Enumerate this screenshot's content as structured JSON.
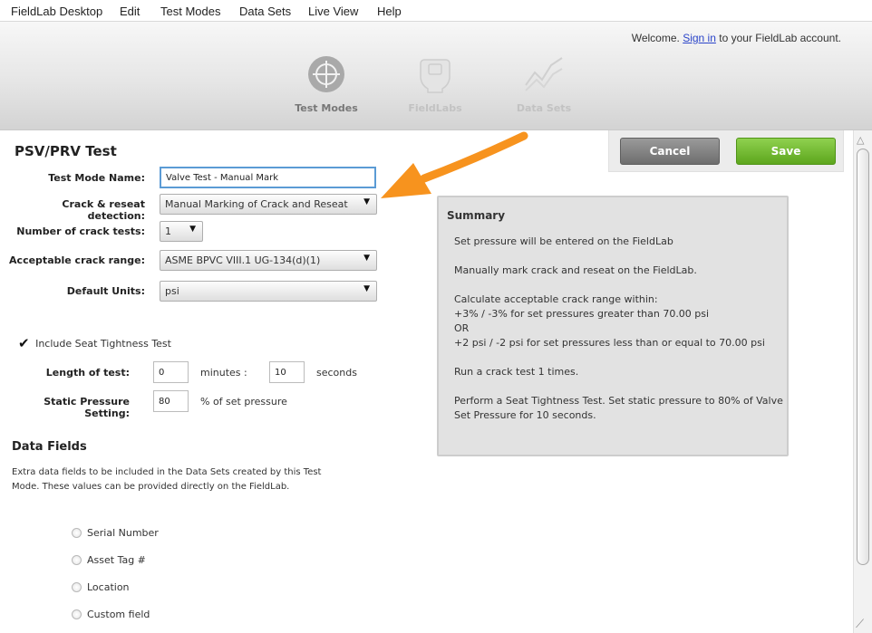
{
  "menu": [
    "FieldLab Desktop",
    "Edit",
    "Test Modes",
    "Data Sets",
    "Live View",
    "Help"
  ],
  "header": {
    "welcome_prefix": "Welcome.",
    "sign_in": "Sign in",
    "welcome_suffix": "to your FieldLab account.",
    "nav": [
      {
        "label": "Test Modes",
        "icon": "crosshair-icon"
      },
      {
        "label": "FieldLabs",
        "icon": "fieldlab-device-icon"
      },
      {
        "label": "Data Sets",
        "icon": "chart-line-icon"
      }
    ]
  },
  "form": {
    "title": "PSV/PRV Test",
    "test_mode_name": {
      "label": "Test Mode Name:",
      "value": "Valve Test - Manual Mark"
    },
    "crack_detection": {
      "label": "Crack & reseat detection:",
      "value": "Manual Marking of Crack and Reseat"
    },
    "num_crack_tests": {
      "label": "Number of crack tests:",
      "value": "1"
    },
    "crack_range": {
      "label": "Acceptable crack range:",
      "value": "ASME BPVC VIII.1 UG-134(d)(1)"
    },
    "default_units": {
      "label": "Default Units:",
      "value": "psi"
    },
    "include_seat": {
      "label": "Include Seat Tightness Test",
      "checked": true
    },
    "length_of_test": {
      "label": "Length of test:",
      "minutes_value": "0",
      "minutes_label": "minutes :",
      "seconds_value": "10",
      "seconds_label": "seconds"
    },
    "static_pressure": {
      "label": "Static Pressure Setting:",
      "value": "80",
      "unit": "% of set pressure"
    }
  },
  "buttons": {
    "cancel": "Cancel",
    "save": "Save"
  },
  "summary": {
    "title": "Summary",
    "lines": [
      "Set pressure will be entered on the FieldLab",
      "Manually mark crack and reseat on the FieldLab.",
      "Calculate acceptable crack range within:",
      "+3% / -3% for set pressures greater than 70.00 psi",
      "OR",
      "+2 psi / -2 psi for set pressures less than or equal to 70.00 psi",
      "Run a crack test 1 times.",
      "Perform a Seat Tightness Test. Set static pressure to 80% of Valve",
      "Set Pressure for 10 seconds."
    ]
  },
  "data_fields": {
    "title": "Data Fields",
    "description": "Extra data fields to be included in the Data Sets created by this Test Mode. These values can be provided directly on the FieldLab.",
    "options": [
      "Serial Number",
      "Asset Tag #",
      "Location",
      "Custom field"
    ]
  },
  "colors": {
    "accent_arrow": "#f7931e",
    "save_green": "#6cbf2a",
    "link_blue": "#2a44c9"
  }
}
